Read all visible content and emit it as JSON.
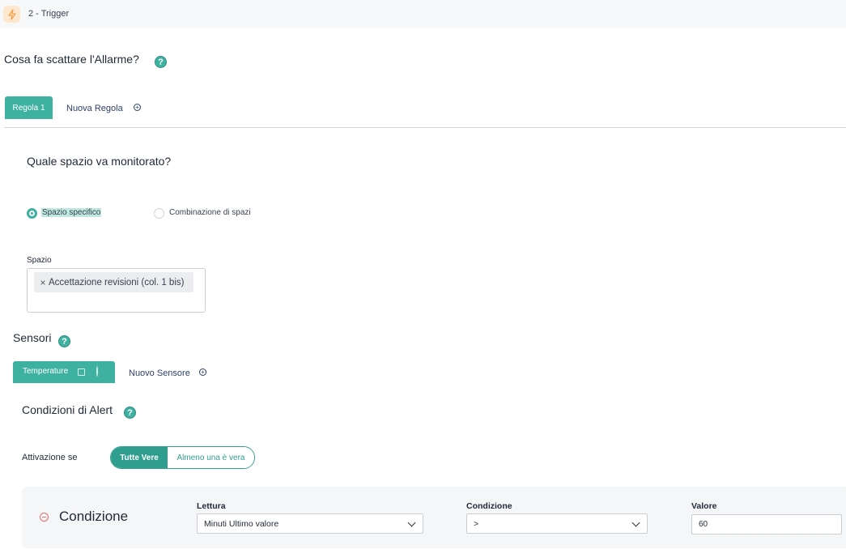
{
  "step": {
    "label": "2 - Trigger",
    "icon": "lightning-icon",
    "accent": "#f0a04b"
  },
  "question_trigger": "Cosa fa scattare l'Allarme?",
  "rules": {
    "active_tab": "Regola 1",
    "new_rule": "Nuova Regola"
  },
  "monitor": {
    "question": "Quale spazio va monitorato?",
    "options": [
      {
        "label": "Spazio specifico",
        "selected": true
      },
      {
        "label": "Combinazione di spazi",
        "selected": false
      }
    ]
  },
  "spazio": {
    "label": "Spazio",
    "chips": [
      "Accettazione revisioni (col. 1 bis)"
    ]
  },
  "sensors": {
    "title": "Sensori",
    "active_tab": "Temperature",
    "new_sensor": "Nuovo Sensore"
  },
  "alert": {
    "title": "Condizioni di Alert",
    "activation_label": "Attivazione se",
    "toggle": {
      "on": "Tutte Vere",
      "off": "Almeno una è vera"
    }
  },
  "condition": {
    "title": "Condizione",
    "lettura": {
      "label": "Lettura",
      "value": "Minuti Ultimo valore"
    },
    "condizione": {
      "label": "Condizione",
      "value": ">"
    },
    "valore": {
      "label": "Valore",
      "value": "60"
    }
  },
  "colors": {
    "accent": "#3fb1a0",
    "accent_dark": "#2f9e8f",
    "danger": "#e46a6a"
  }
}
